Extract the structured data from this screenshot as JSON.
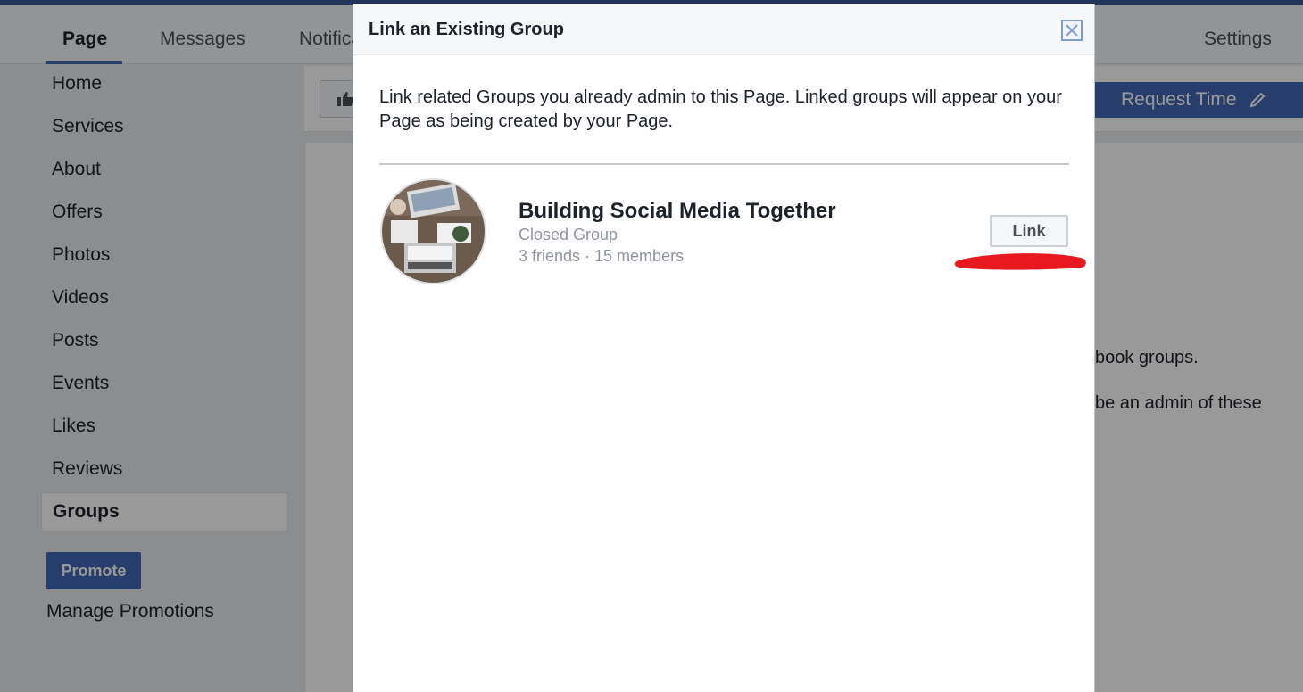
{
  "page_nav": {
    "tabs": [
      "Page",
      "Messages",
      "Notifica",
      "Settings"
    ]
  },
  "sidebar": {
    "items": [
      "Home",
      "Services",
      "About",
      "Offers",
      "Photos",
      "Videos",
      "Posts",
      "Events",
      "Likes",
      "Reviews",
      "Groups"
    ],
    "selected": "Groups",
    "promote_label": "Promote",
    "manage_label": "Manage Promotions"
  },
  "action_bar": {
    "request_label": "Request Time"
  },
  "background": {
    "line1": "book groups.",
    "line2": "be an admin of these"
  },
  "modal": {
    "title": "Link an Existing Group",
    "description": "Link related Groups you already admin to this Page. Linked groups will appear on your Page as being created by your Page.",
    "group": {
      "name": "Building Social Media Together",
      "type": "Closed Group",
      "members": "3 friends · 15 members"
    },
    "link_label": "Link"
  },
  "colors": {
    "brand": "#4267b2",
    "annotation": "#e8191e"
  },
  "icons": [
    "thumbs-up-icon",
    "pencil-icon",
    "close-icon"
  ]
}
